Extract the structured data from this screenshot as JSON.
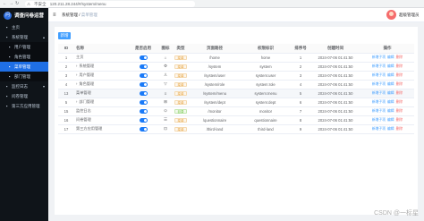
{
  "browser": {
    "insecure_label": "不安全",
    "url": "120.211.28.244/#/system/menu"
  },
  "app": {
    "title": "调查问卷运营"
  },
  "sidebar": {
    "items": [
      {
        "label": "主页",
        "icon": "home-icon",
        "type": "top"
      },
      {
        "label": "系统管理",
        "icon": "gear-icon",
        "type": "top",
        "arrow": "▴"
      },
      {
        "label": "用户管理",
        "icon": "user-icon",
        "type": "sub"
      },
      {
        "label": "角色管理",
        "icon": "role-icon",
        "type": "sub"
      },
      {
        "label": "菜单管理",
        "icon": "menu-icon",
        "type": "sub",
        "active": true
      },
      {
        "label": "部门管理",
        "icon": "dept-icon",
        "type": "sub"
      },
      {
        "label": "监控日志",
        "icon": "monitor-icon",
        "type": "top",
        "arrow": "▾"
      },
      {
        "label": "问卷管理",
        "icon": "survey-icon",
        "type": "top"
      },
      {
        "label": "第三方应用管理",
        "icon": "app-icon",
        "type": "top"
      }
    ]
  },
  "header": {
    "breadcrumb_home": "系统管理",
    "breadcrumb_current": "菜单管理",
    "username": "超级管理员"
  },
  "toolbar": {
    "add_label": "新增"
  },
  "table": {
    "headers": [
      "ID",
      "名称",
      "是否启用",
      "图标",
      "类型",
      "页面路径",
      "权限标识",
      "排序号",
      "创建时间",
      "操作"
    ],
    "rows": [
      {
        "id": "1",
        "name": "主页",
        "icon": "⌂",
        "type": "菜单",
        "type_color": "orange",
        "path": "/home",
        "perm": "home",
        "sort": "1",
        "time": "2024-07-06 01:41:50"
      },
      {
        "id": "2",
        "name": "系统管理",
        "expander": "›",
        "icon": "⚙",
        "type": "菜单",
        "type_color": "orange",
        "path": "/system",
        "perm": "system",
        "sort": "2",
        "time": "2024-07-06 01:41:50"
      },
      {
        "id": "3",
        "name": "用户管理",
        "expander": "›",
        "icon": "♙",
        "type": "菜单",
        "type_color": "orange",
        "path": "/system/user",
        "perm": "system:user",
        "sort": "3",
        "time": "2024-07-06 01:41:50"
      },
      {
        "id": "4",
        "name": "角色管理",
        "expander": "›",
        "icon": "▽",
        "type": "菜单",
        "type_color": "orange",
        "path": "/system/role",
        "perm": "system:role",
        "sort": "4",
        "time": "2024-07-06 01:41:50"
      },
      {
        "id": "13",
        "name": "菜单管理",
        "icon": "≡",
        "type": "菜单",
        "type_color": "orange",
        "path": "/system/menu",
        "perm": "system:menu",
        "sort": "5",
        "time": "2024-07-06 01:41:50",
        "highlight": true
      },
      {
        "id": "5",
        "name": "部门管理",
        "expander": "›",
        "icon": "⊞",
        "type": "菜单",
        "type_color": "orange",
        "path": "/system/dept",
        "perm": "system:dept",
        "sort": "6",
        "time": "2024-07-06 01:41:50"
      },
      {
        "id": "15",
        "name": "监控日志",
        "icon": "⊙",
        "type": "目录",
        "type_color": "green",
        "path": "/monitor",
        "perm": "monitor",
        "sort": "7",
        "time": "2024-07-06 01:41:50"
      },
      {
        "id": "16",
        "name": "问卷管理",
        "icon": "☰",
        "type": "菜单",
        "type_color": "orange",
        "path": "/questionnaire",
        "perm": "questionnaire",
        "sort": "8",
        "time": "2024-07-06 01:41:50"
      },
      {
        "id": "17",
        "name": "第三方应用管理",
        "icon": "⊡",
        "type": "菜单",
        "type_color": "orange",
        "path": "/third-land",
        "perm": "third-land",
        "sort": "9",
        "time": "2024-07-06 01:41:50"
      }
    ],
    "ops": {
      "add_sub": "新增子项",
      "edit": "编辑",
      "delete": "删除"
    }
  },
  "watermark": "CSDN @一标星"
}
